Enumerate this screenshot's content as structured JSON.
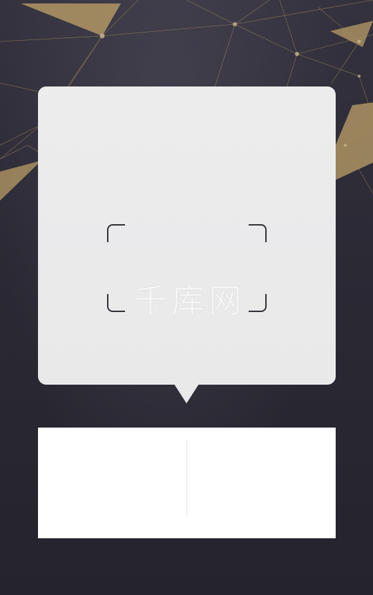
{
  "watermark": {
    "text": "千库网"
  },
  "colors": {
    "background": "#2a2833",
    "card": "#e9e9ea",
    "accent_gold": "#a88f62",
    "frame": "#2f2f35",
    "panel": "#ffffff"
  },
  "icons": {
    "scan_frame": "scan-frame-icon"
  }
}
